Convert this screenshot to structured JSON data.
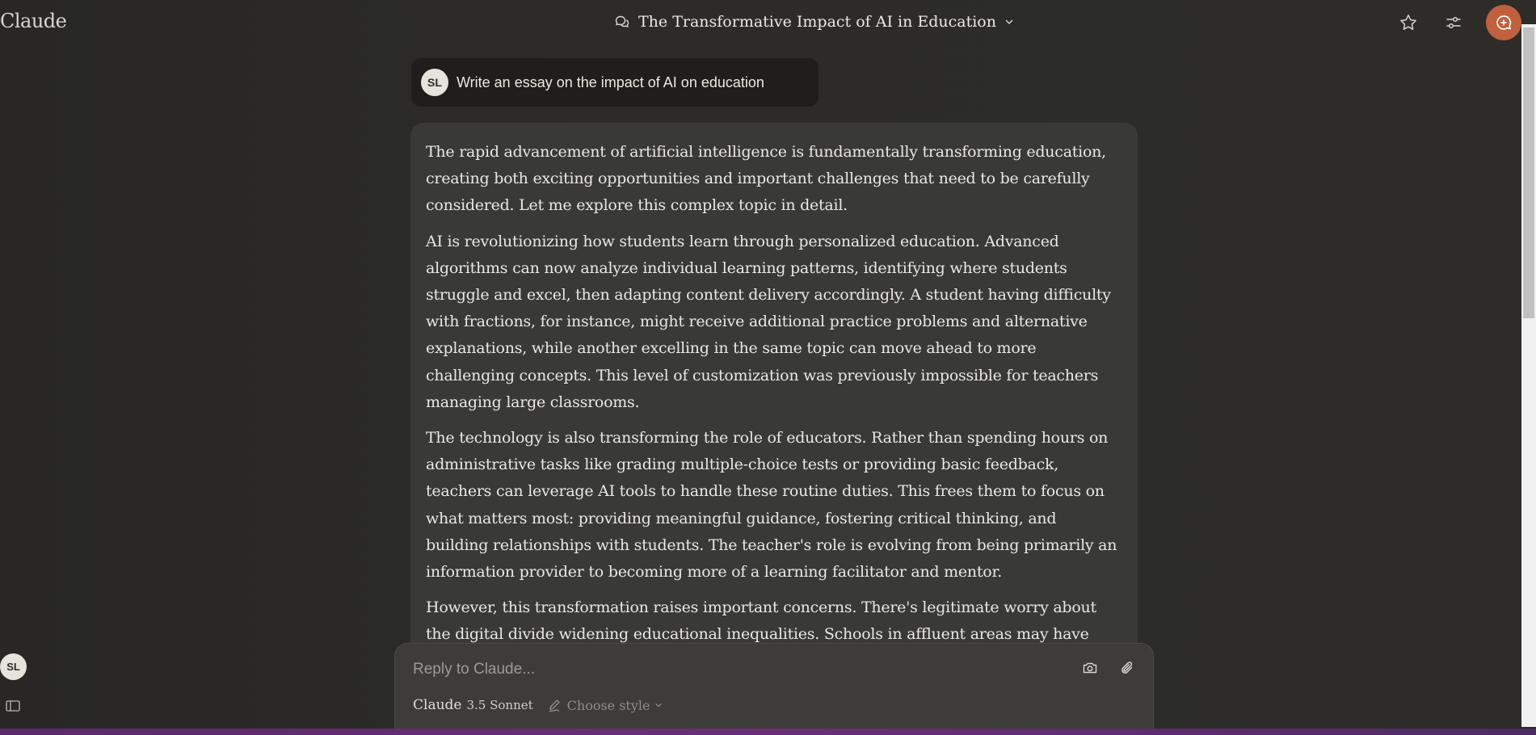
{
  "app": {
    "logo": "Claude",
    "accent_color": "#c0603c"
  },
  "header": {
    "conversation_title": "The Transformative Impact of AI in Education",
    "icons": {
      "chat": "chat-bubbles-icon",
      "dropdown": "chevron-down-icon",
      "star": "star-icon",
      "settings": "sliders-icon",
      "new_chat": "new-chat-icon"
    }
  },
  "user_message": {
    "avatar_initials": "SL",
    "text": "Write an essay on the impact of AI on education"
  },
  "assistant_message": {
    "paragraphs": [
      "The rapid advancement of artificial intelligence is fundamentally transforming education, creating both exciting opportunities and important challenges that need to be carefully considered. Let me explore this complex topic in detail.",
      "AI is revolutionizing how students learn through personalized education. Advanced algorithms can now analyze individual learning patterns, identifying where students struggle and excel, then adapting content delivery accordingly. A student having difficulty with fractions, for instance, might receive additional practice problems and alternative explanations, while another excelling in the same topic can move ahead to more challenging concepts. This level of customization was previously impossible for teachers managing large classrooms.",
      "The technology is also transforming the role of educators. Rather than spending hours on administrative tasks like grading multiple-choice tests or providing basic feedback, teachers can leverage AI tools to handle these routine duties. This frees them to focus on what matters most: providing meaningful guidance, fostering critical thinking, and building relationships with students. The teacher's role is evolving from being primarily an information provider to becoming more of a learning facilitator and mentor.",
      "However, this transformation raises important concerns. There's legitimate worry about the digital divide widening educational inequalities. Schools in affluent areas may have"
    ]
  },
  "composer": {
    "placeholder": "Reply to Claude...",
    "model_brand": "Claude",
    "model_name": "3.5 Sonnet",
    "style_label": "Choose style",
    "icons": {
      "camera": "camera-icon",
      "attach": "paperclip-icon",
      "style": "pen-icon"
    }
  },
  "sidebar": {
    "avatar_initials": "SL",
    "toggle_icon": "sidebar-toggle-icon"
  }
}
